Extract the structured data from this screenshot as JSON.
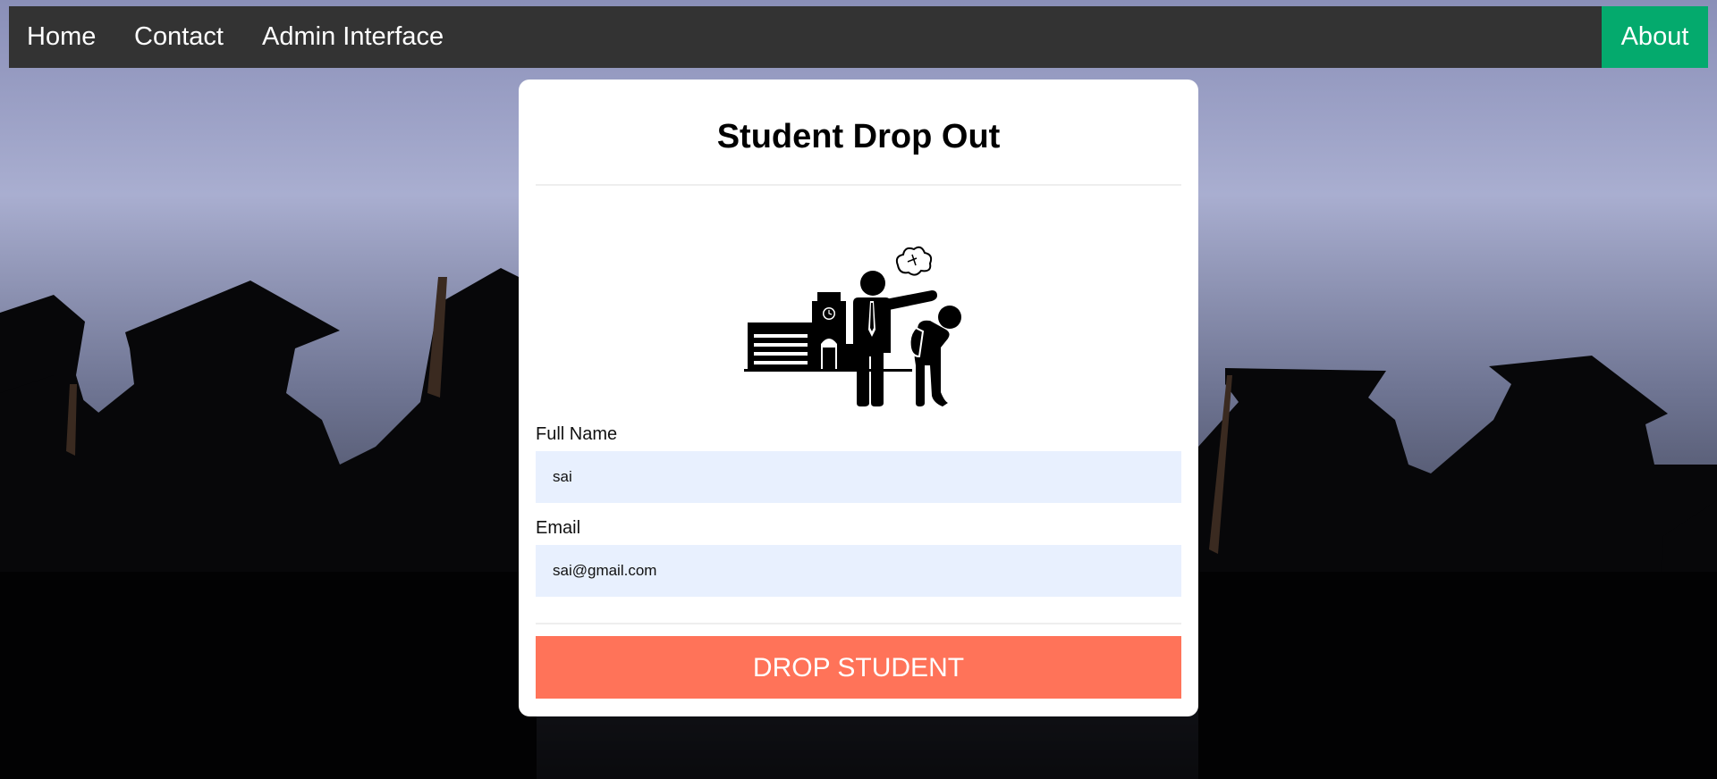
{
  "nav": {
    "home": "Home",
    "contact": "Contact",
    "admin": "Admin Interface",
    "about": "About"
  },
  "form": {
    "title": "Student Drop Out",
    "illustration": "teacher-expelling-student-illustration",
    "full_name_label": "Full Name",
    "full_name_value": "sai",
    "email_label": "Email",
    "email_value": "sai@gmail.com",
    "submit_label": "DROP STUDENT"
  },
  "colors": {
    "nav_bg": "#333333",
    "about_bg": "#04aa6d",
    "input_bg": "#e8f0fe",
    "button_bg": "#ff7359"
  }
}
